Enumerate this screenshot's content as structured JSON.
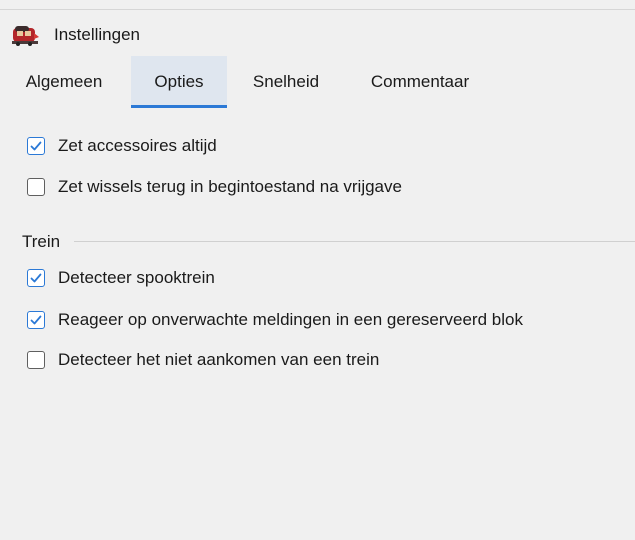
{
  "window": {
    "title": "Instellingen",
    "icon": "locomotive-icon"
  },
  "tabs": [
    {
      "label": "Algemeen",
      "selected": false
    },
    {
      "label": "Opties",
      "selected": true
    },
    {
      "label": "Snelheid",
      "selected": false
    },
    {
      "label": "Commentaar",
      "selected": false
    }
  ],
  "options": {
    "general": [
      {
        "label": "Zet accessoires altijd",
        "checked": true
      },
      {
        "label": "Zet wissels terug in begintoestand na vrijgave",
        "checked": false
      }
    ],
    "train_group": {
      "label": "Trein",
      "items": [
        {
          "label": "Detecteer spooktrein",
          "checked": true
        },
        {
          "label": "Reageer op onverwachte meldingen in een gereserveerd blok",
          "checked": true
        },
        {
          "label": "Detecteer het niet aankomen van een trein",
          "checked": false
        }
      ]
    }
  },
  "colors": {
    "accent": "#2b79d6",
    "background": "#f0f0f0",
    "selected_tab_bg": "#dfe6ef"
  }
}
